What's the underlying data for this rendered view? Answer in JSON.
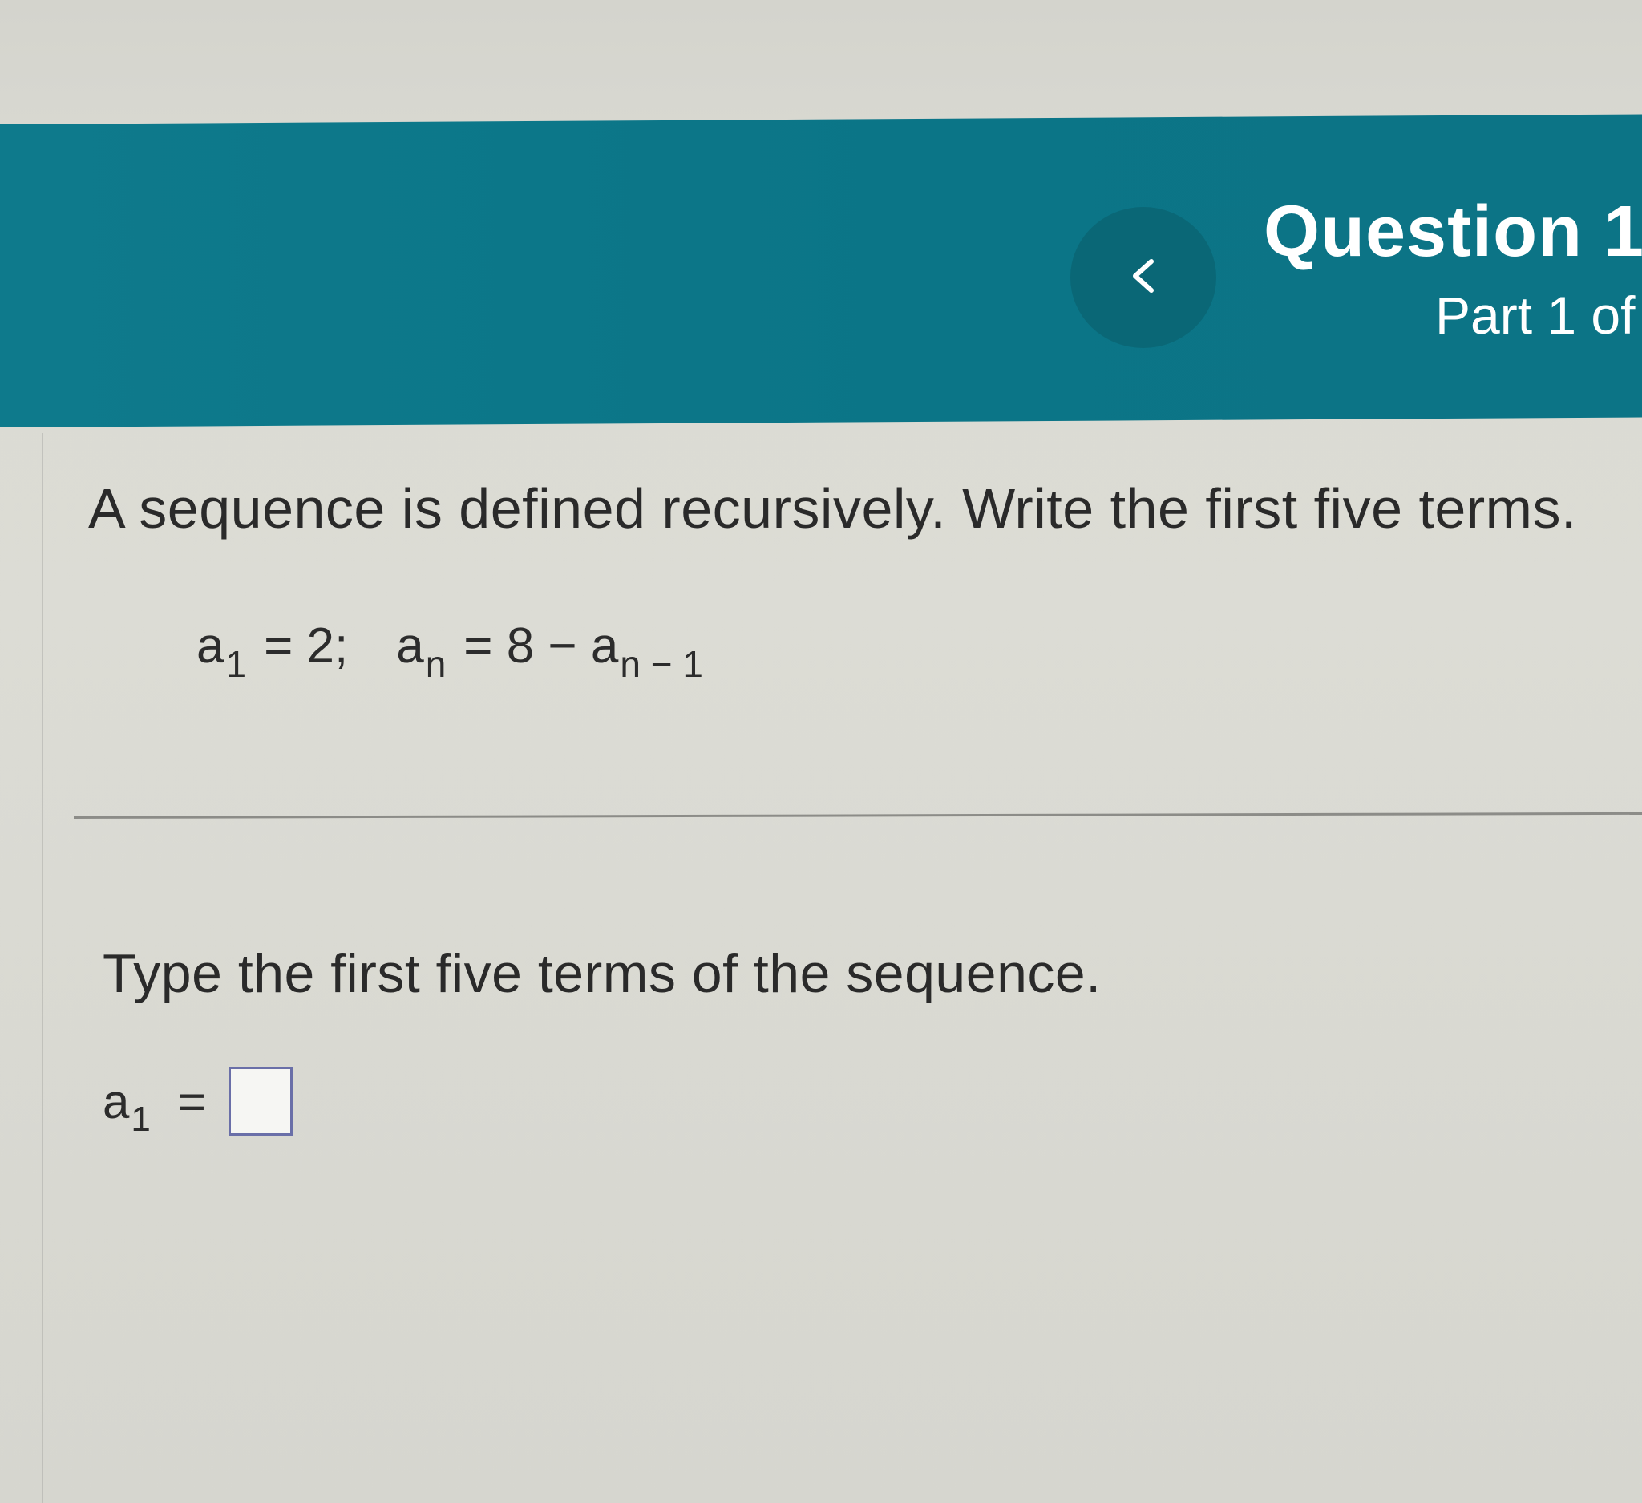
{
  "header": {
    "back_icon": "chevron-left-icon",
    "question_title": "Question 1",
    "part_label": "Part 1 of"
  },
  "problem": {
    "prompt": "A sequence is defined recursively. Write the first five terms.",
    "formula": {
      "a1_base": "a",
      "a1_sub": "1",
      "a1_rhs": "= 2;",
      "an_base": "a",
      "an_sub": "n",
      "an_rhs": "= 8 − a",
      "an_prev_sub": "n − 1"
    }
  },
  "answer": {
    "instruction": "Type the first five terms of the sequence.",
    "term_base": "a",
    "term_sub": "1",
    "equals": "=",
    "input_value": ""
  },
  "colors": {
    "header_bg": "#0e7a8c",
    "back_button_bg": "#0a6776",
    "input_border": "#6a6fa8"
  }
}
